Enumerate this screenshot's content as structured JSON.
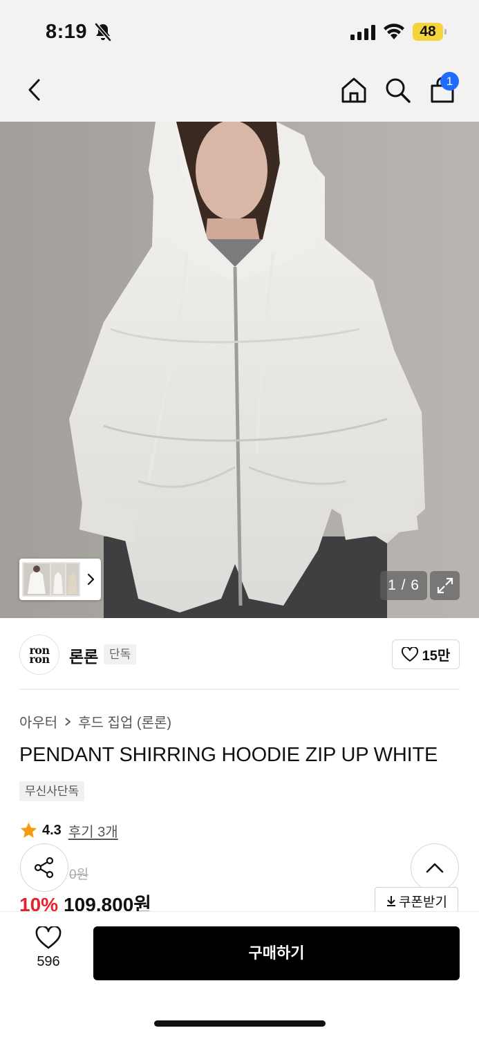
{
  "status_bar": {
    "time": "8:19",
    "battery": "48"
  },
  "nav": {
    "cart_count": "1",
    "icons": [
      "back-icon",
      "home-icon",
      "search-icon",
      "shopping-bag-icon"
    ]
  },
  "gallery": {
    "counter": "1 / 6"
  },
  "brand": {
    "logo_text_top": "ron",
    "logo_text_bottom": "ron",
    "name": "론론",
    "tag": "단독",
    "likes": "15만"
  },
  "breadcrumb": {
    "category": "아우터",
    "subcategory": "후드 집업 (론론)"
  },
  "product": {
    "title": "PENDANT SHIRRING HOODIE ZIP UP WHITE",
    "badge": "무신사단독",
    "rating": "4.3",
    "reviews": "후기 3개",
    "original_price_visible": "0원",
    "discount": "10%",
    "price": "109,800원",
    "coupon": "쿠폰받기"
  },
  "bottom_bar": {
    "wish_count": "596",
    "buy_label": "구매하기"
  },
  "colors": {
    "accent_red": "#e5222e",
    "badge_blue": "#1f6bff",
    "star": "#f49b12"
  }
}
